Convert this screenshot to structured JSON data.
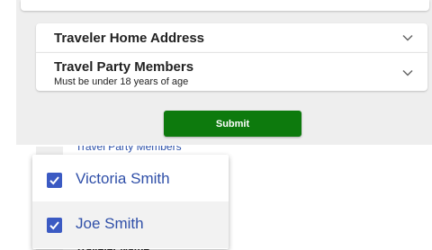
{
  "form": {
    "sections": [
      {
        "title": "Traveler Home Address",
        "icon": "chevron-down-icon"
      },
      {
        "title": "Travel Party Members",
        "subtitle": "Must be under 18 years of age",
        "icon": "chevron-down-icon"
      }
    ],
    "submit_label": "Submit"
  },
  "dropdown": {
    "behind_label_top": "Travel Party Members",
    "behind_label_bottom": "Traveler Name",
    "options": [
      {
        "label": "Victoria Smith",
        "checked": true
      },
      {
        "label": "Joe Smith",
        "checked": true
      }
    ]
  },
  "colors": {
    "accent": "#3b5ac3",
    "submit": "#0d7a0d",
    "panel": "#eeeeee"
  }
}
